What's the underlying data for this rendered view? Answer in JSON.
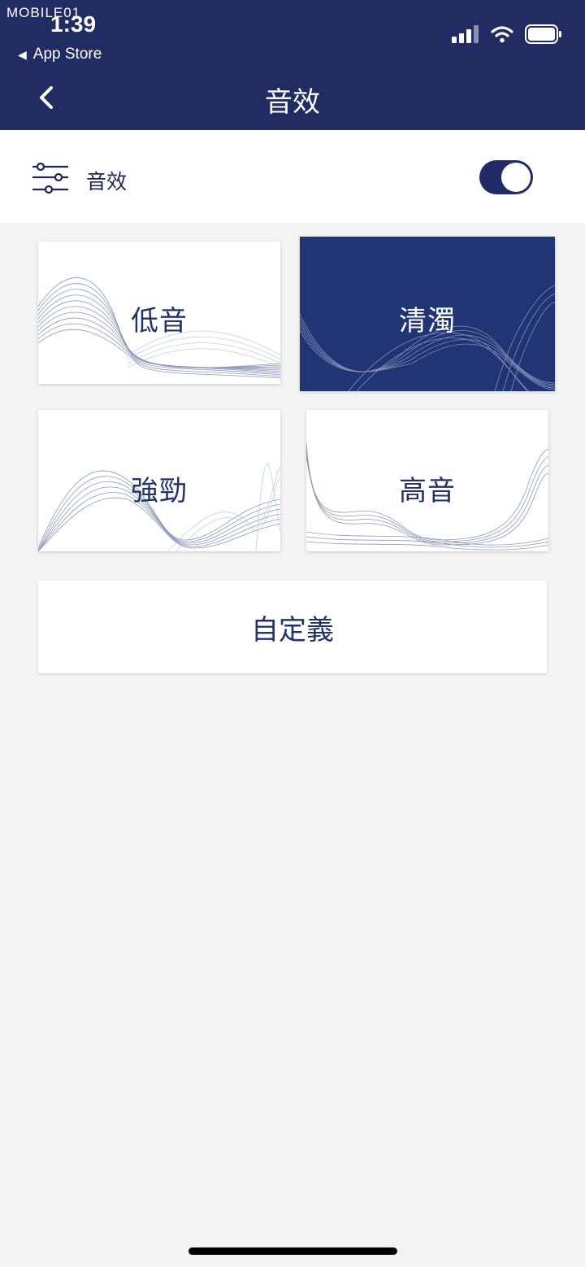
{
  "status_bar": {
    "watermark": "MOBILE01",
    "time": "1:39",
    "back_app": "App Store"
  },
  "nav": {
    "title": "音效"
  },
  "sound_effect_row": {
    "label": "音效",
    "toggle_on": true
  },
  "presets": [
    {
      "label": "低音",
      "selected": false
    },
    {
      "label": "清濁",
      "selected": true
    },
    {
      "label": "強勁",
      "selected": false
    },
    {
      "label": "高音",
      "selected": false
    }
  ],
  "custom": {
    "label": "自定義"
  },
  "colors": {
    "header_bg": "#212c63",
    "accent": "#1f2a66",
    "selected_card": "#213474",
    "text_dark": "#243164",
    "page_bg": "#f3f3f3"
  }
}
